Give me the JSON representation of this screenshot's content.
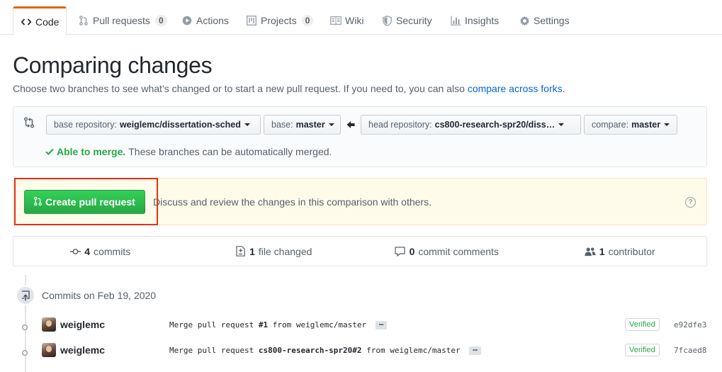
{
  "tabs": [
    {
      "label": "Code",
      "icon": "code-icon",
      "selected": true
    },
    {
      "label": "Pull requests",
      "icon": "pull-request-icon",
      "count": "0"
    },
    {
      "label": "Actions",
      "icon": "play-icon"
    },
    {
      "label": "Projects",
      "icon": "project-icon",
      "count": "0"
    },
    {
      "label": "Wiki",
      "icon": "book-icon"
    },
    {
      "label": "Security",
      "icon": "shield-icon"
    },
    {
      "label": "Insights",
      "icon": "graph-icon"
    },
    {
      "label": "Settings",
      "icon": "gear-icon"
    }
  ],
  "header": {
    "title": "Comparing changes",
    "subtitle": "Choose two branches to see what’s changed or to start a new pull request. If you need to, you can also",
    "subtitle_link": "compare across forks",
    "subtitle_end": "."
  },
  "range": {
    "base_repo_label": "base repository:",
    "base_repo_value": "weiglemc/dissertation-sched",
    "base_label": "base:",
    "base_value": "master",
    "head_repo_label": "head repository:",
    "head_repo_value": "cs800-research-spr20/diss…",
    "compare_label": "compare:",
    "compare_value": "master",
    "merge_ok": "Able to merge.",
    "merge_text": "These branches can be automatically merged."
  },
  "create": {
    "button_label": "Create pull request",
    "description": "Discuss and review the changes in this comparison with others.",
    "help": "?"
  },
  "summary": [
    {
      "count": "4",
      "label": "commits",
      "icon": "commit-icon"
    },
    {
      "count": "1",
      "label": "file changed",
      "icon": "file-diff-icon"
    },
    {
      "count": "0",
      "label": "commit comments",
      "icon": "comment-icon"
    },
    {
      "count": "1",
      "label": "contributor",
      "icon": "people-icon"
    }
  ],
  "commits": {
    "group_title": "Commits on Feb 19, 2020",
    "items": [
      {
        "author": "weiglemc",
        "message_pre": "Merge pull request ",
        "message_ref": "#1",
        "message_post": " from weiglemc/master",
        "verified": "Verified",
        "sha": "e92dfe3"
      },
      {
        "author": "weiglemc",
        "message_pre": "Merge pull request ",
        "message_ref": "cs800-research-spr20#2",
        "message_post": " from weiglemc/master",
        "verified": "Verified",
        "sha": "7fcaed8"
      }
    ],
    "ellipsis": "…"
  },
  "colors": {
    "accent_tab": "#e36209",
    "link": "#0366d6",
    "success": "#28a745",
    "create_bg": "#fffbea",
    "highlight": "#e0311c"
  }
}
